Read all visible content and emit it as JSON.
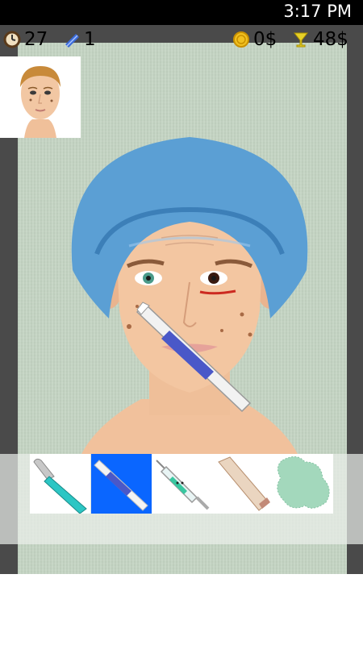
{
  "status_bar": {
    "time": "3:17 PM"
  },
  "hud": {
    "timer_value": "27",
    "bandage_count": "1",
    "coins": "0$",
    "target_reward": "48$"
  },
  "tools": [
    {
      "name": "scalpel",
      "selected": false
    },
    {
      "name": "laser-pen",
      "selected": true
    },
    {
      "name": "syringe",
      "selected": false
    },
    {
      "name": "ointment-tube",
      "selected": false
    },
    {
      "name": "gauze-patch",
      "selected": false
    }
  ],
  "colors": {
    "selected_tool_bg": "#0a66ff",
    "surgical_cap": "#5b9fd4",
    "skin": "#f2c29d",
    "wall": "#c5d5c4"
  }
}
